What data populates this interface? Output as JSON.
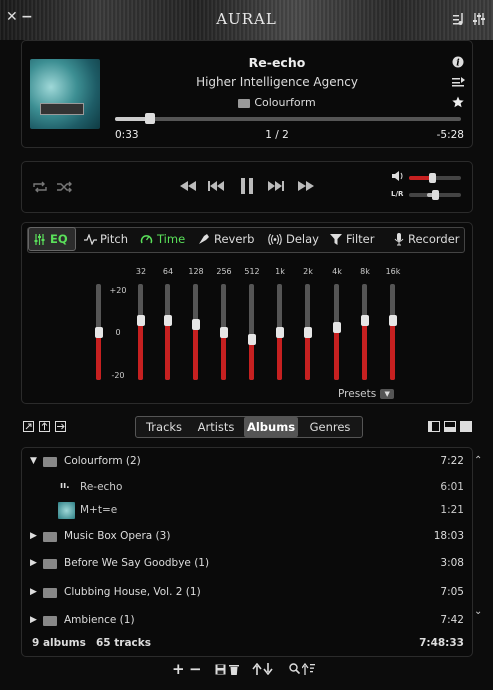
{
  "app": {
    "title": "AURAL"
  },
  "window_controls": {
    "close": "✕",
    "minimize": "−",
    "playlist_icon": "♪",
    "settings_icon": "⫶"
  },
  "now_playing": {
    "title": "Re-echo",
    "artist": "Higher Intelligence Agency",
    "album": "Colourform",
    "elapsed": "0:33",
    "track_position": "1 / 2",
    "remaining": "-5:28",
    "seek_fraction": 0.1
  },
  "player": {
    "volume_fraction": 0.45,
    "balance_label": "L/R",
    "balance_fraction": 0.5
  },
  "effects": {
    "tabs": [
      {
        "label": "EQ",
        "icon": "eq-icon"
      },
      {
        "label": "Pitch",
        "icon": "pitch-icon"
      },
      {
        "label": "Time",
        "icon": "time-icon"
      },
      {
        "label": "Reverb",
        "icon": "reverb-icon"
      },
      {
        "label": "Delay",
        "icon": "delay-icon"
      },
      {
        "label": "Filter",
        "icon": "filter-icon"
      },
      {
        "label": "Recorder",
        "icon": "mic-icon"
      }
    ],
    "selected_tab": "EQ",
    "active_color": "#5ae05a",
    "time_color": "#5ae05a"
  },
  "eq": {
    "scale": {
      "top": "+20",
      "mid": "0",
      "bottom": "-20"
    },
    "bands": [
      {
        "label": "32",
        "gain_db": 5
      },
      {
        "label": "64",
        "gain_db": 5
      },
      {
        "label": "128",
        "gain_db": 3
      },
      {
        "label": "256",
        "gain_db": 0
      },
      {
        "label": "512",
        "gain_db": -3
      },
      {
        "label": "1k",
        "gain_db": 0
      },
      {
        "label": "2k",
        "gain_db": 0
      },
      {
        "label": "4k",
        "gain_db": 2
      },
      {
        "label": "8k",
        "gain_db": 5
      },
      {
        "label": "16k",
        "gain_db": 5
      }
    ],
    "preamp_gain_db": 0,
    "presets_label": "Presets"
  },
  "library": {
    "view_tabs": [
      "Tracks",
      "Artists",
      "Albums",
      "Genres"
    ],
    "selected_view": "Albums",
    "albums": [
      {
        "name": "Colourform (2)",
        "duration": "7:22",
        "expanded": true,
        "tracks": [
          {
            "name": "Re-echo",
            "duration": "6:01",
            "playing": true
          },
          {
            "name": "M+t=e",
            "duration": "1:21",
            "playing": false
          }
        ]
      },
      {
        "name": "Music Box Opera (3)",
        "duration": "18:03",
        "expanded": false
      },
      {
        "name": "Before We Say Goodbye (1)",
        "duration": "3:08",
        "expanded": false
      },
      {
        "name": "Clubbing House, Vol. 2 (1)",
        "duration": "7:05",
        "expanded": false
      },
      {
        "name": "Ambience (1)",
        "duration": "7:42",
        "expanded": false
      }
    ],
    "summary": {
      "albums": "9 albums",
      "tracks": "65 tracks",
      "total_duration": "7:48:33"
    }
  }
}
